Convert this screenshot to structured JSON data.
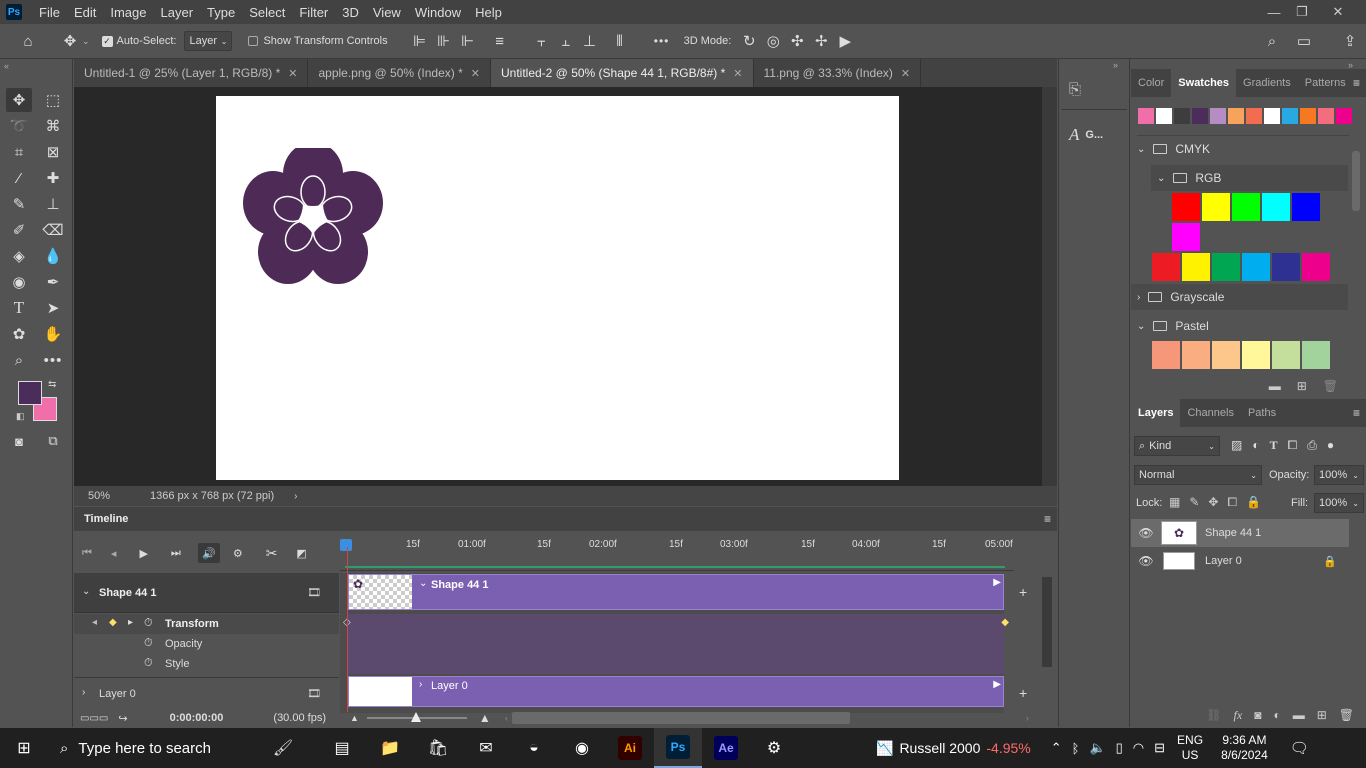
{
  "menu": {
    "logo": "Ps",
    "items": [
      "File",
      "Edit",
      "Image",
      "Layer",
      "Type",
      "Select",
      "Filter",
      "3D",
      "View",
      "Window",
      "Help"
    ]
  },
  "options_bar": {
    "auto_select_label": "Auto-Select:",
    "auto_select_value": "Layer",
    "show_transform_label": "Show Transform Controls",
    "mode_3d_label": "3D Mode:",
    "more": "•••"
  },
  "doc_tabs": [
    {
      "label": "Untitled-1 @ 25% (Layer 1, RGB/8) *",
      "active": false
    },
    {
      "label": "apple.png @ 50% (Index) *",
      "active": false
    },
    {
      "label": "Untitled-2 @ 50% (Shape 44 1, RGB/8#) *",
      "active": true
    },
    {
      "label": "11.png @ 33.3% (Index)",
      "active": false
    }
  ],
  "status": {
    "zoom": "50%",
    "doc_size": "1366 px x 768 px (72 ppi)"
  },
  "timeline": {
    "title": "Timeline",
    "ruler_labels": [
      "15f",
      "01:00f",
      "15f",
      "02:00f",
      "15f",
      "03:00f",
      "15f",
      "04:00f",
      "15f",
      "05:00f"
    ],
    "tracks": [
      {
        "name": "Shape 44 1",
        "clip_label": "Shape 44 1"
      },
      {
        "name": "Layer 0",
        "clip_label": "Layer 0"
      }
    ],
    "props": [
      "Transform",
      "Opacity",
      "Style"
    ],
    "timecode": "0:00:00:00",
    "fps": "(30.00 fps)"
  },
  "collapsed_panel": {
    "glyph_label": "G..."
  },
  "swatches": {
    "tabs": [
      "Color",
      "Swatches",
      "Gradients",
      "Patterns"
    ],
    "active_tab": "Swatches",
    "recent": [
      "#f06ea9",
      "#ffffff",
      "#3d3d3d",
      "#4a2d5a",
      "#b68cc4",
      "#f7a35c",
      "#f26d50",
      "#ffffff",
      "#29a9e1",
      "#f47920",
      "#f26d7d",
      "#ec008c"
    ],
    "groups": [
      {
        "name": "CMYK",
        "expanded": true
      },
      {
        "name": "RGB",
        "expanded": true,
        "colors": [
          "#ff0000",
          "#ffff00",
          "#00ff00",
          "#00ffff",
          "#0000ff",
          "#ff00ff"
        ]
      },
      {
        "name": "",
        "colors": [
          "#ed1c24",
          "#fff200",
          "#00a651",
          "#00aeef",
          "#2e3192",
          "#ec008c"
        ]
      },
      {
        "name": "Grayscale",
        "expanded": false
      },
      {
        "name": "Pastel",
        "expanded": true,
        "colors": [
          "#f7977a",
          "#f9ad81",
          "#fdc68a",
          "#fff79a",
          "#c4df9b",
          "#a3d39c"
        ]
      }
    ]
  },
  "layers": {
    "tabs": [
      "Layers",
      "Channels",
      "Paths"
    ],
    "active_tab": "Layers",
    "kind": "Kind",
    "blend_mode": "Normal",
    "opacity_label": "Opacity:",
    "opacity": "100%",
    "lock_label": "Lock:",
    "fill_label": "Fill:",
    "fill": "100%",
    "items": [
      {
        "name": "Shape 44 1",
        "selected": true,
        "locked": false
      },
      {
        "name": "Layer 0",
        "selected": false,
        "locked": true
      }
    ]
  },
  "colors": {
    "foreground": "#4a2d5a",
    "background": "#f06ea9",
    "flower": "#4e2a57",
    "clip": "#7b5fb1"
  },
  "taskbar": {
    "search_placeholder": "Type here to search",
    "stock_name": "Russell 2000",
    "stock_change": "-4.95%",
    "lang1": "ENG",
    "lang2": "US",
    "time": "9:36 AM",
    "date": "8/6/2024",
    "apps": [
      "Ai",
      "Ps",
      "Ae"
    ]
  }
}
